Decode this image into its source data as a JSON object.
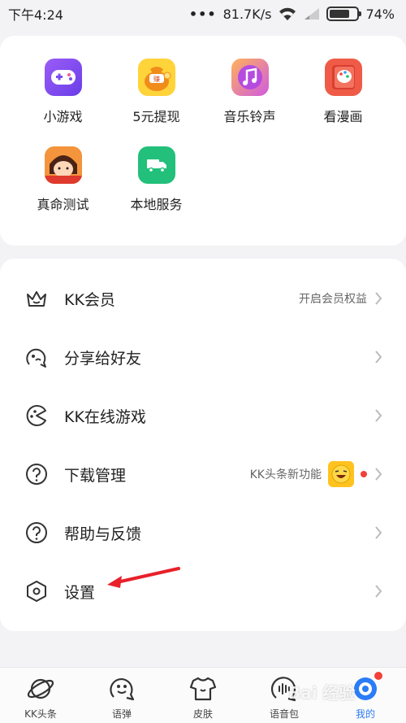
{
  "status_bar": {
    "time": "下午4:24",
    "network_speed": "81.7K/s",
    "battery_percent": "74%",
    "battery_level": 0.74
  },
  "apps": [
    {
      "label": "小游戏",
      "icon": "gamepad-icon",
      "color": "#7b4cf0"
    },
    {
      "label": "5元提现",
      "icon": "money-bag-icon",
      "color": "#f7a21b"
    },
    {
      "label": "音乐铃声",
      "icon": "music-note-icon",
      "color": "#d46ad8"
    },
    {
      "label": "看漫画",
      "icon": "palette-book-icon",
      "color": "#ee5a48"
    },
    {
      "label": "真命测试",
      "icon": "cartoon-girl-icon",
      "color": "#f08a2c"
    },
    {
      "label": "本地服务",
      "icon": "truck-icon",
      "color": "#22c07a"
    }
  ],
  "menu": {
    "vip": {
      "label": "KK会员",
      "hint": "开启会员权益"
    },
    "share": {
      "label": "分享给好友"
    },
    "games": {
      "label": "KK在线游戏"
    },
    "downloads": {
      "label": "下载管理",
      "hint": "KK头条新功能"
    },
    "help": {
      "label": "帮助与反馈"
    },
    "settings": {
      "label": "设置"
    }
  },
  "bottom_nav": [
    {
      "label": "KK头条",
      "icon": "planet-icon",
      "active": false
    },
    {
      "label": "语弹",
      "icon": "chat-face-icon",
      "active": false
    },
    {
      "label": "皮肤",
      "icon": "tshirt-icon",
      "active": false
    },
    {
      "label": "语音包",
      "icon": "voice-bubble-icon",
      "active": false
    },
    {
      "label": "我的",
      "icon": "profile-icon",
      "active": true
    }
  ],
  "watermark": "Bai 经验",
  "colors": {
    "accent": "#2b7cf6",
    "badge_red": "#f2413a",
    "annotation_arrow": "#e8202a"
  }
}
